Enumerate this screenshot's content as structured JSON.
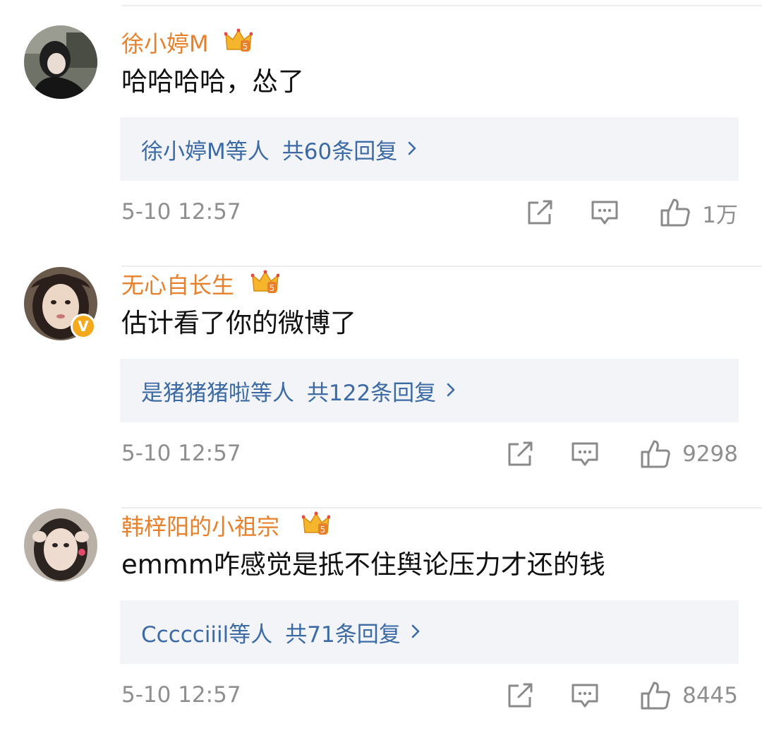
{
  "comments": [
    {
      "username": "徐小婷M",
      "text": "哈哈哈哈，怂了",
      "verified": false,
      "replies": {
        "users": "徐小婷M等人",
        "count": "共60条回复"
      },
      "timestamp": "5-10 12:57",
      "likes": "1万"
    },
    {
      "username": "无心自长生",
      "text": "估计看了你的微博了",
      "verified": true,
      "replies": {
        "users": "是猪猪猪啦等人",
        "count": "共122条回复"
      },
      "timestamp": "5-10 12:57",
      "likes": "9298"
    },
    {
      "username": "韩梓阳的小祖宗",
      "text": "emmm咋感觉是抵不住舆论压力才还的钱",
      "verified": false,
      "replies": {
        "users": "Ccccciiil等人",
        "count": "共71条回复"
      },
      "timestamp": "5-10 12:57",
      "likes": "8445"
    }
  ],
  "colors": {
    "username": "#e8802b",
    "reply_link": "#3c6aa5",
    "meta_gray": "#8f8f8f",
    "reply_bg": "#f2f4f7",
    "crown_gold": "#f5b52c",
    "verify_badge": "#f4a81c"
  },
  "icons": {
    "member_crown": "crown-icon",
    "verified": "verified-badge-icon",
    "share": "share-icon",
    "reply": "comment-icon",
    "like": "thumbs-up-icon",
    "chevron": "chevron-right-icon"
  }
}
